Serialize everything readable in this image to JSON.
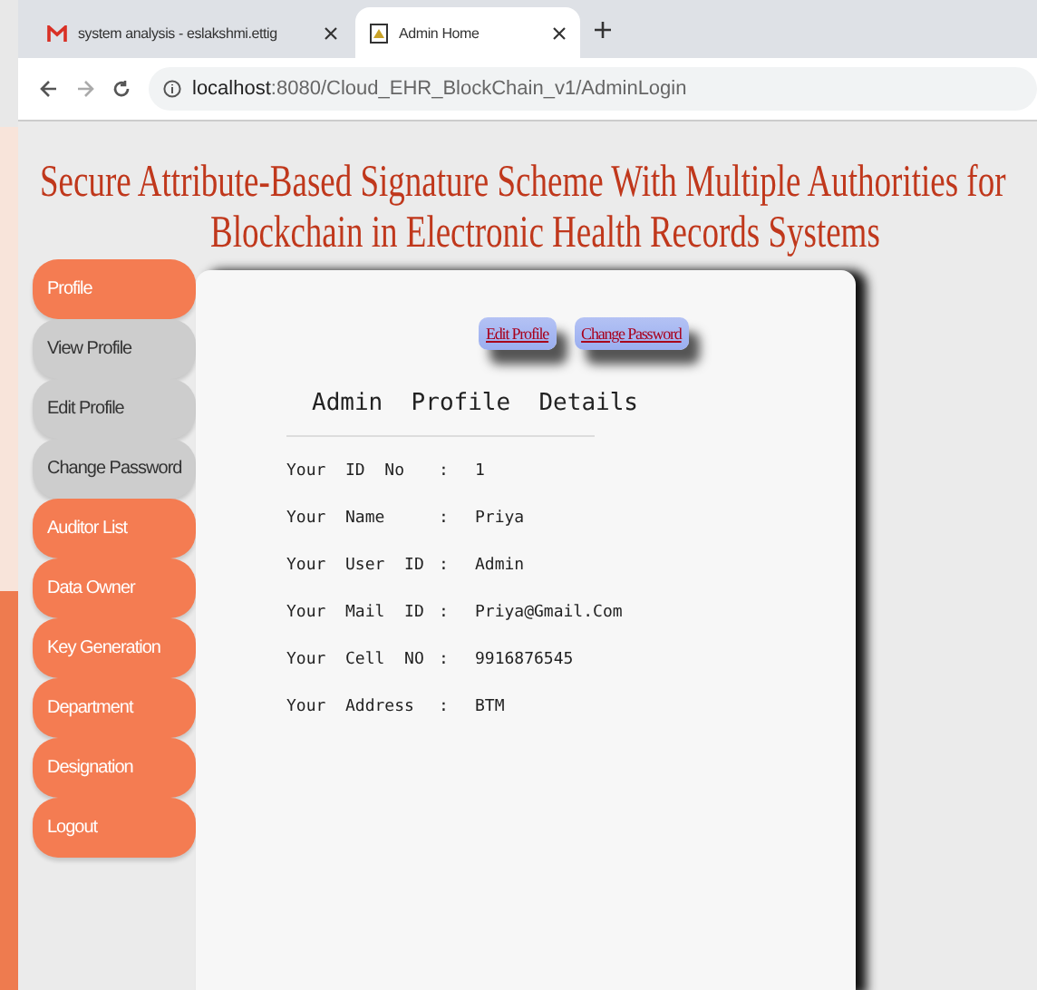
{
  "browser": {
    "tabs": [
      {
        "title": "system analysis - eslakshmi.ettig",
        "selected": false
      },
      {
        "title": "Admin Home",
        "selected": true
      }
    ],
    "url_host": "localhost",
    "url_path": ":8080/Cloud_EHR_BlockChain_v1/AdminLogin"
  },
  "page": {
    "title_lines": [
      "Secure Attribute-Based Signature Scheme With Multiple Authorities for",
      "Blockchain in Electronic Health Records Systems"
    ]
  },
  "sidebar": {
    "items": [
      {
        "label": "Profile",
        "kind": "main"
      },
      {
        "label": "View Profile",
        "kind": "sub"
      },
      {
        "label": "Edit Profile",
        "kind": "sub"
      },
      {
        "label": "Change Password",
        "kind": "sub"
      },
      {
        "label": "Auditor List",
        "kind": "main"
      },
      {
        "label": "Data Owner",
        "kind": "main"
      },
      {
        "label": "Key Generation",
        "kind": "main"
      },
      {
        "label": "Department",
        "kind": "main"
      },
      {
        "label": "Designation",
        "kind": "main"
      },
      {
        "label": "Logout",
        "kind": "main"
      }
    ]
  },
  "profile": {
    "buttons": [
      "Edit Profile",
      "Change Password"
    ],
    "heading": "Admin  Profile  Details",
    "rows": [
      {
        "label": "Your  ID  No",
        "sep": ":",
        "value": "1"
      },
      {
        "label": "Your  Name",
        "sep": ":",
        "value": "Priya"
      },
      {
        "label": "Your  User  ID",
        "sep": ":",
        "value": "Admin"
      },
      {
        "label": "Your  Mail  ID",
        "sep": ":",
        "value": "Priya@Gmail.Com"
      },
      {
        "label": "Your  Cell  NO",
        "sep": ":",
        "value": "9916876545"
      },
      {
        "label": "Your  Address",
        "sep": ":",
        "value": "BTM"
      }
    ]
  }
}
